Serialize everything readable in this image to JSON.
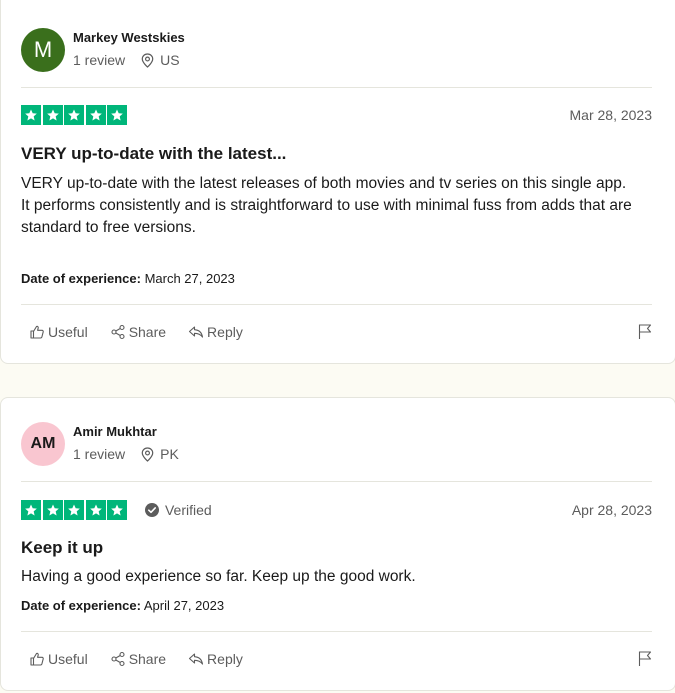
{
  "reviews": [
    {
      "avatar_initials": "M",
      "avatar_color": "#3a6f1c",
      "name": "Markey Westskies",
      "review_count": "1 review",
      "location": "US",
      "rating": 5,
      "verified": null,
      "date": "Mar 28, 2023",
      "title": "VERY up-to-date with the latest...",
      "body_lines": [
        "VERY up-to-date with the latest releases of both movies and tv series on this single app.",
        "It performs consistently and is straightforward to use with minimal fuss from adds that are standard to free versions."
      ],
      "experience_label": "Date of experience:",
      "experience_date": "March 27, 2023"
    },
    {
      "avatar_initials": "AM",
      "avatar_color": "#f9c6d0",
      "name": "Amir Mukhtar",
      "review_count": "1 review",
      "location": "PK",
      "rating": 5,
      "verified": "Verified",
      "date": "Apr 28, 2023",
      "title": "Keep it up",
      "body_lines": [
        "Having a good experience so far. Keep up the good work."
      ],
      "experience_label": "Date of experience:",
      "experience_date": "April 27, 2023"
    }
  ],
  "actions": {
    "useful": "Useful",
    "share": "Share",
    "reply": "Reply"
  },
  "icons": {
    "star": "star-icon",
    "location": "location-pin-icon",
    "verified": "check-circle-icon",
    "useful": "thumbs-up-icon",
    "share": "share-icon",
    "reply": "reply-icon",
    "flag": "flag-icon"
  },
  "colors": {
    "star_green": "#00b67a",
    "page_bg": "#fcfbf3",
    "muted_text": "#5c5c5c"
  }
}
